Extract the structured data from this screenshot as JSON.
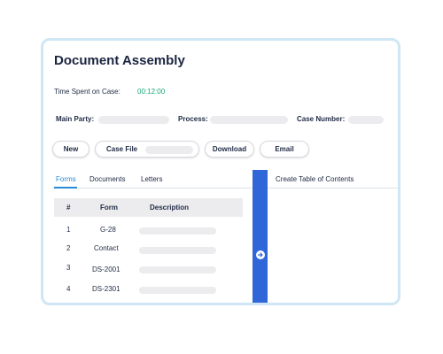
{
  "header": {
    "title": "Document Assembly"
  },
  "time": {
    "label": "Time Spent on Case:",
    "value": "00:12:00"
  },
  "meta": {
    "main_party_label": "Main Party:",
    "process_label": "Process:",
    "case_number_label": "Case Number:"
  },
  "toolbar": {
    "new_label": "New",
    "case_file_label": "Case File",
    "download_label": "Download",
    "email_label": "Email"
  },
  "tabs": [
    {
      "label": "Forms",
      "active": true
    },
    {
      "label": "Documents",
      "active": false
    },
    {
      "label": "Letters",
      "active": false
    }
  ],
  "table": {
    "headers": [
      "#",
      "Form",
      "Description"
    ],
    "rows": [
      {
        "num": "1",
        "form": "G-28"
      },
      {
        "num": "2",
        "form": "Contact"
      },
      {
        "num": "3",
        "form": "DS-2001"
      },
      {
        "num": "4",
        "form": "DS-2301"
      }
    ]
  },
  "toc": {
    "label": "Create Table of Contents"
  },
  "colors": {
    "accent": "#2a8ad6",
    "time_value": "#1aa67a",
    "splitter": "#2f67d9",
    "card_border": "#cfe6f5",
    "placeholder": "#ececef"
  },
  "icons": {
    "splitter": "arrow-right-circle-icon"
  }
}
